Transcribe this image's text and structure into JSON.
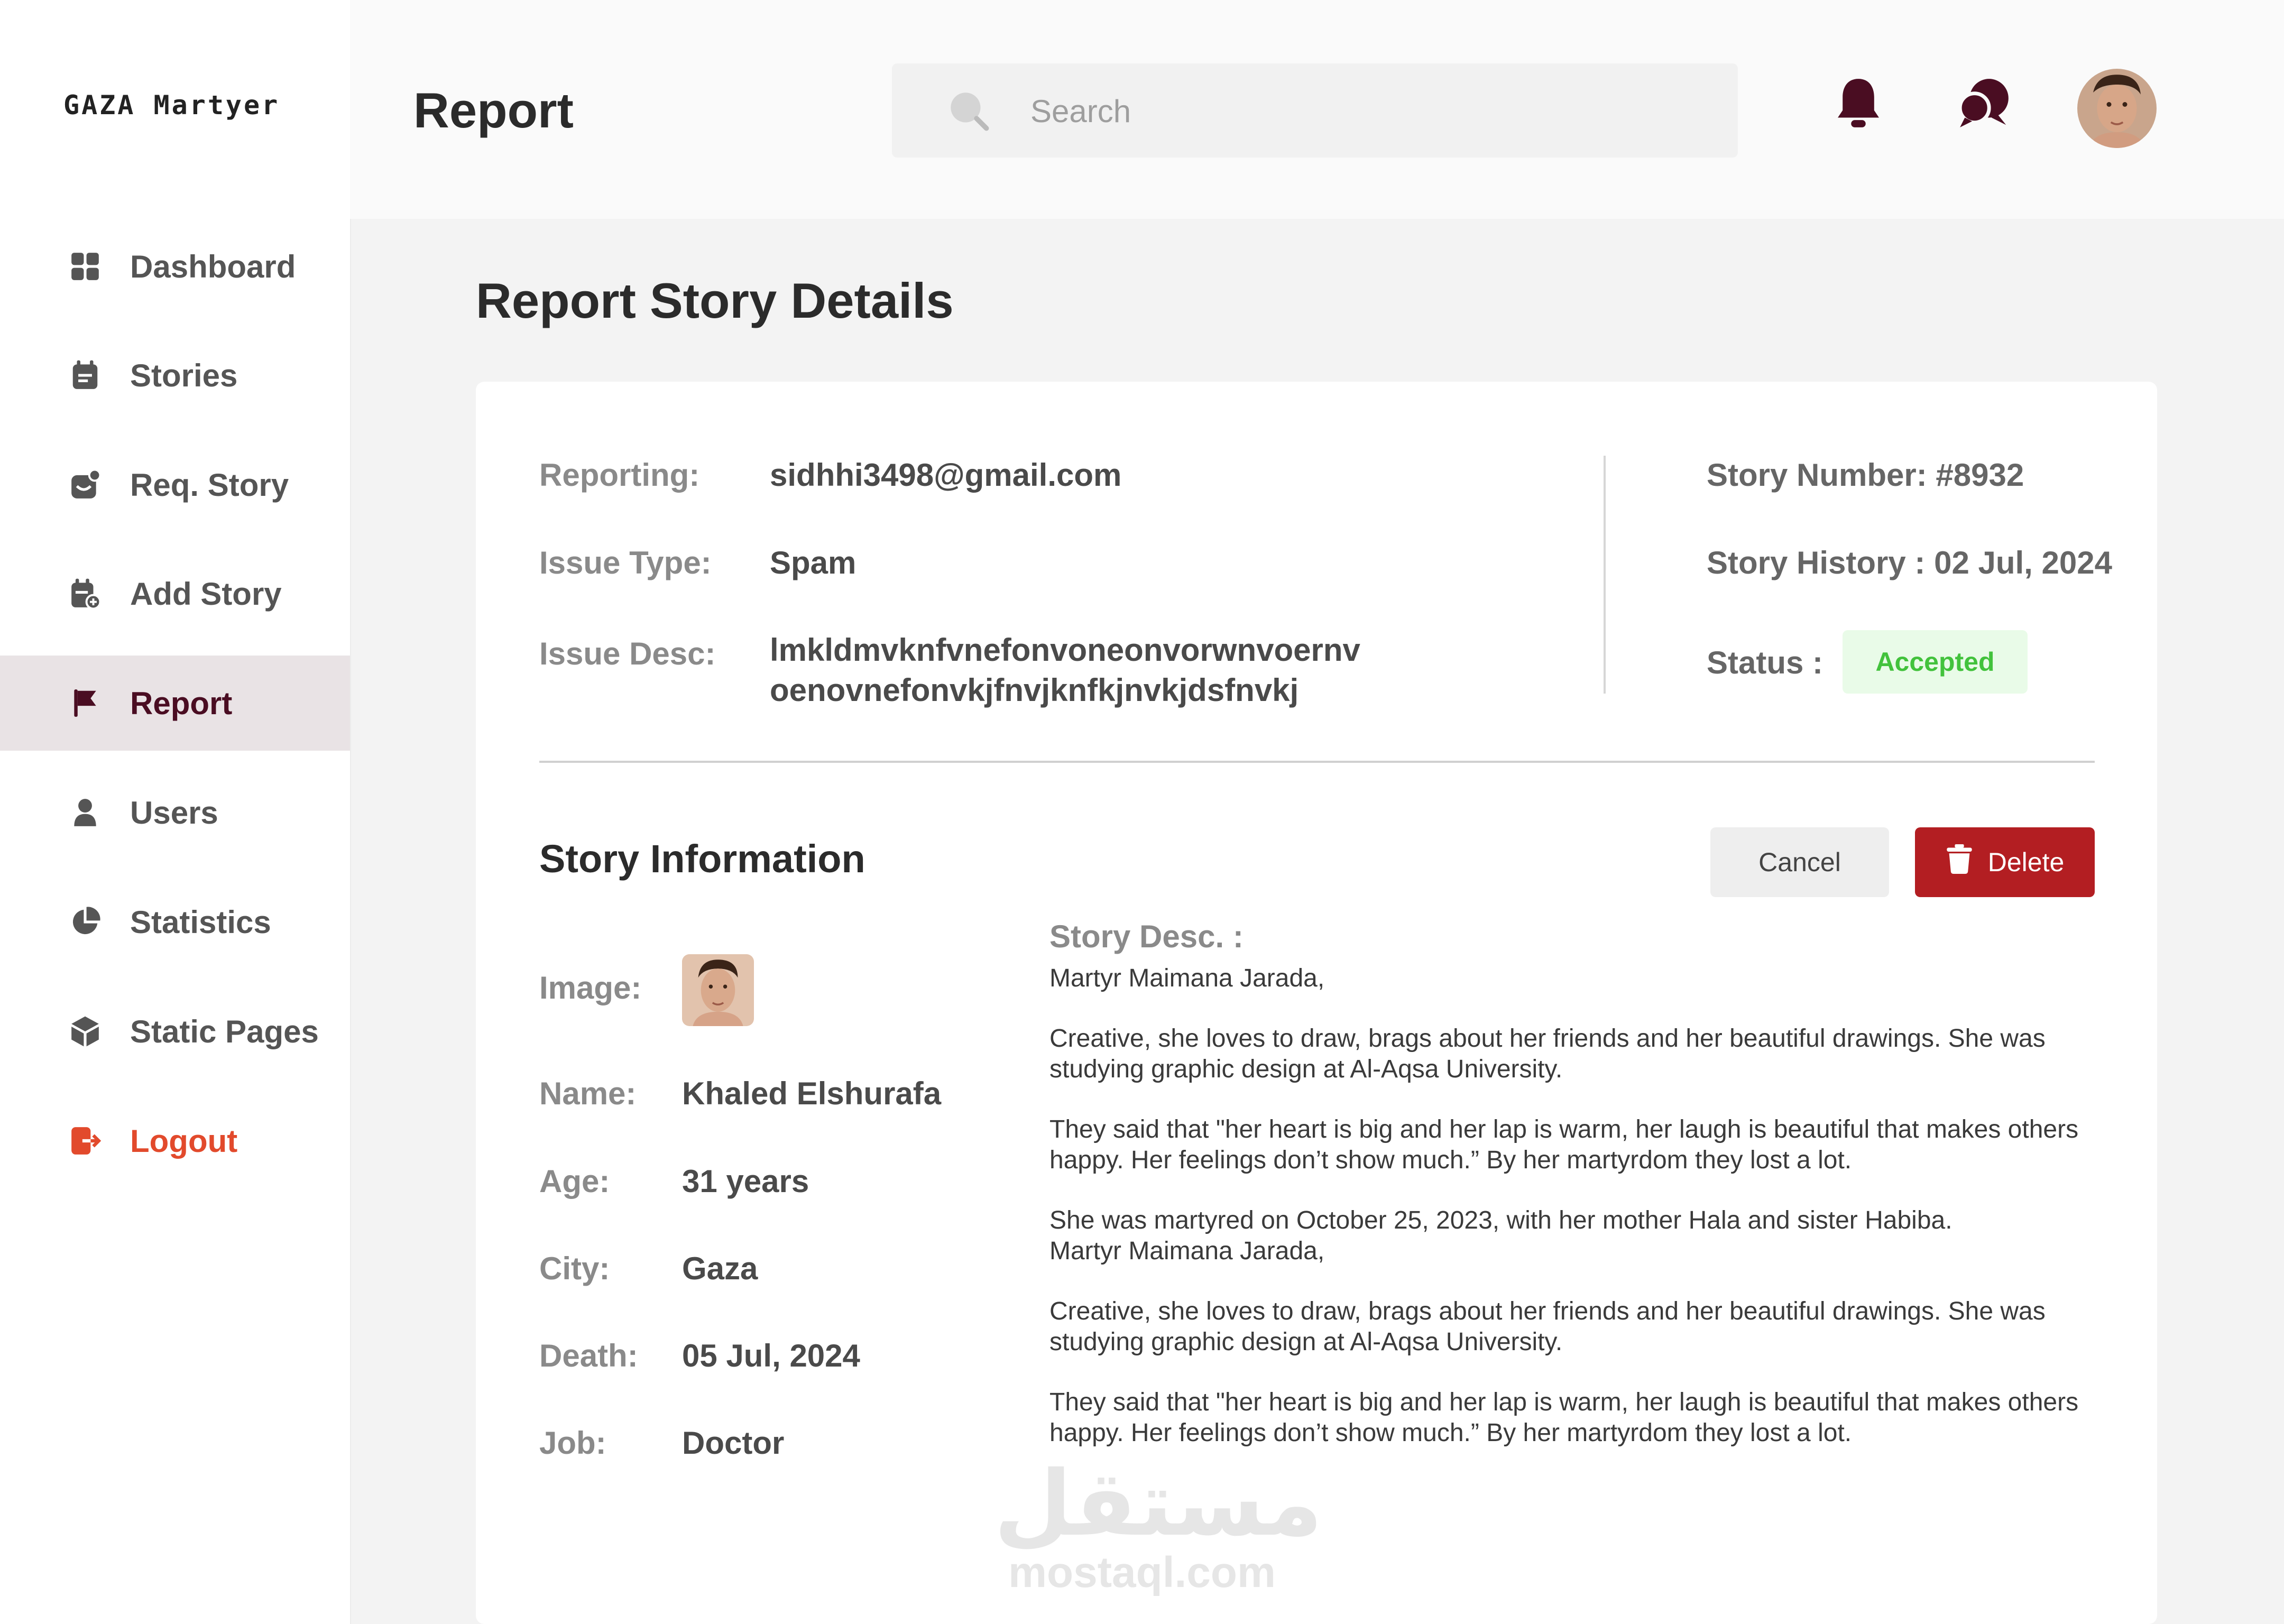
{
  "app": {
    "logo": "GAZA Martyer"
  },
  "sidebar": {
    "items": [
      {
        "label": "Dashboard",
        "icon": "dashboard-grid-icon"
      },
      {
        "label": "Stories",
        "icon": "calendar-icon"
      },
      {
        "label": "Req. Story",
        "icon": "inbox-request-icon"
      },
      {
        "label": "Add Story",
        "icon": "calendar-add-icon"
      },
      {
        "label": "Report",
        "icon": "flag-icon",
        "active": true
      },
      {
        "label": "Users",
        "icon": "user-icon"
      },
      {
        "label": "Statistics",
        "icon": "pie-chart-icon"
      },
      {
        "label": "Static Pages",
        "icon": "cube-icon"
      },
      {
        "label": "Logout",
        "icon": "logout-icon"
      }
    ]
  },
  "header": {
    "title": "Report",
    "search": {
      "placeholder": "Search",
      "value": ""
    },
    "icons": [
      "bell-icon",
      "chat-icon",
      "avatar"
    ]
  },
  "main": {
    "title": "Report Story Details",
    "report": {
      "reporting_label": "Reporting:",
      "reporting_value": "sidhhi3498@gmail.com",
      "issue_type_label": "Issue Type:",
      "issue_type_value": "Spam",
      "issue_desc_label": "Issue Desc:",
      "issue_desc_line1": "lmkldmvknfvnefonvoneonvorwnvoernv",
      "issue_desc_line2": "oenovnefonvkjfnvjknfkjnvkjdsfnvkj",
      "story_number": "Story Number: #8932",
      "story_history": "Story History : 02 Jul, 2024",
      "status_label": "Status :",
      "status_value": "Accepted"
    },
    "story": {
      "section_title": "Story Information",
      "cancel_label": "Cancel",
      "delete_label": "Delete",
      "image_label": "Image:",
      "name_label": "Name:",
      "name_value": "Khaled Elshurafa",
      "age_label": "Age:",
      "age_value": "31 years",
      "city_label": "City:",
      "city_value": "Gaza",
      "death_label": "Death:",
      "death_value": "05 Jul, 2024",
      "job_label": "Job:",
      "job_value": "Doctor",
      "desc_title": "Story Desc. :",
      "desc": [
        "Martyr Maimana Jarada,",
        "Creative, she loves to draw, brags about her friends and her beautiful drawings. She was studying graphic design at Al-Aqsa University.",
        "They said that \"her heart is big and her lap is warm, her laugh is beautiful that makes others happy. Her feelings don’t show much.” By her martyrdom they lost a lot.",
        "She was martyred on October 25, 2023, with her mother Hala and sister Habiba.",
        "Martyr Maimana Jarada,",
        "Creative, she loves to draw, brags about her friends and her beautiful drawings. She was studying graphic design at Al-Aqsa University.",
        "They said that \"her heart is big and her lap is warm, her laugh is beautiful that makes others happy. Her feelings don’t show much.” By her martyrdom they lost a lot."
      ]
    }
  },
  "watermark": {
    "arabic": "مستقل",
    "latin": "mostaql.com"
  },
  "colors": {
    "accent": "#4a0d22",
    "delete": "#b31e22",
    "status_bg": "#e9fbe8",
    "status_text": "#42c23c",
    "logout": "#e24a2c"
  }
}
